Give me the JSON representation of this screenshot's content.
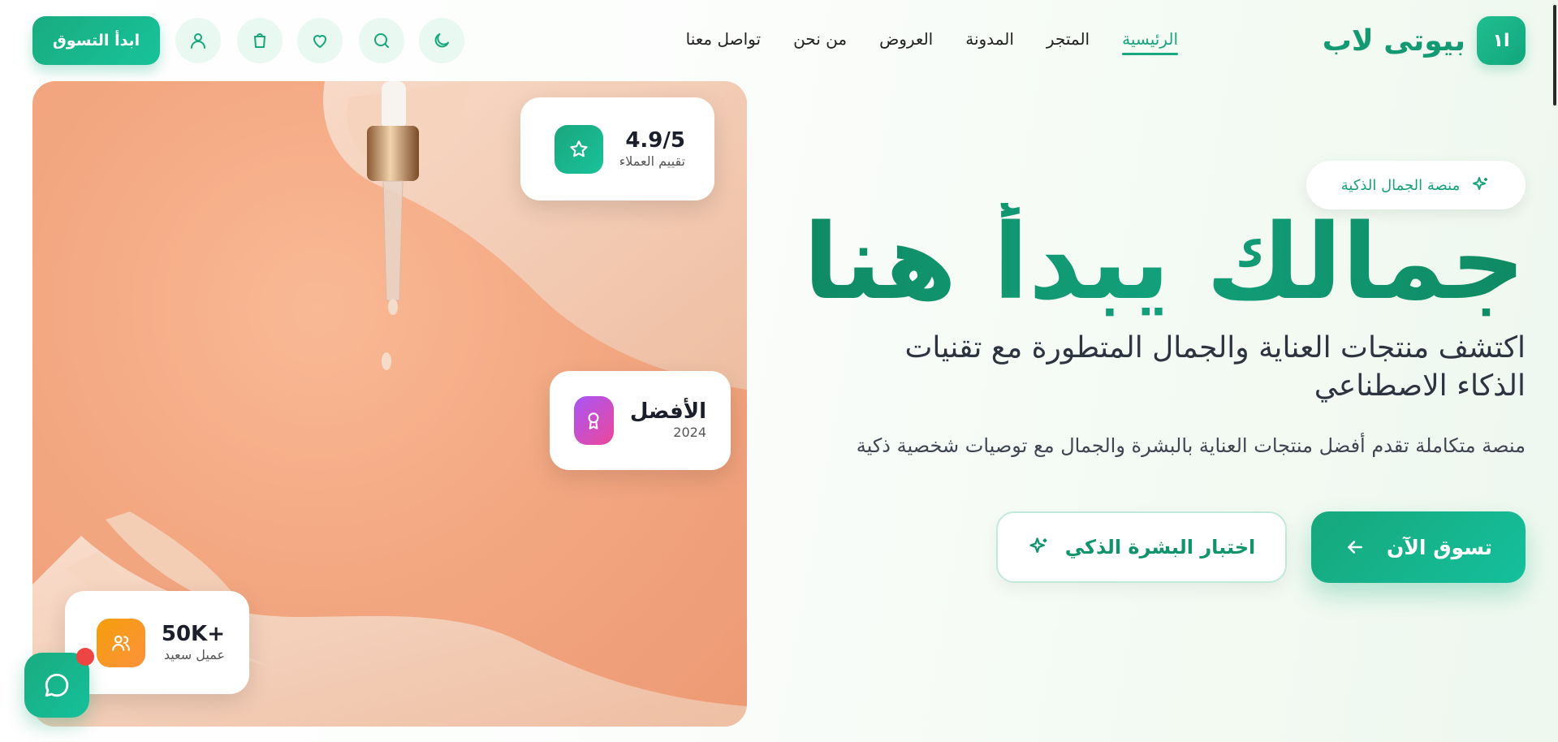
{
  "brand": {
    "logo_mark": "ا١",
    "name": "بيوتى لاب",
    "accent_color": "#17a77c",
    "accent_light": "#e9f8f1",
    "chat_badge_color": "#ef4444"
  },
  "nav": {
    "items": [
      {
        "label": "الرئيسية",
        "active": true
      },
      {
        "label": "المتجر",
        "active": false
      },
      {
        "label": "المدونة",
        "active": false
      },
      {
        "label": "العروض",
        "active": false
      },
      {
        "label": "من نحن",
        "active": false
      },
      {
        "label": "تواصل معنا",
        "active": false
      }
    ]
  },
  "header_actions": {
    "icons": [
      "moon-icon",
      "search-icon",
      "heart-icon",
      "shopping-bag-icon",
      "user-icon"
    ],
    "start_shopping_label": "ابدأ التسوق"
  },
  "hero": {
    "badge_icon": "sparkles-icon",
    "badge_text": "منصة الجمال الذكية",
    "title": "جمالك يبدأ هنا",
    "subtitle": "اكتشف منتجات العناية والجمال المتطورة مع تقنيات الذكاء الاصطناعي",
    "description": "منصة متكاملة تقدم أفضل منتجات العناية بالبشرة والجمال مع توصيات شخصية ذكية",
    "primary_cta": {
      "label": "تسوق الآن",
      "icon": "arrow-left-icon"
    },
    "secondary_cta": {
      "label": "اختبار البشرة الذكي",
      "icon": "sparkles-icon"
    }
  },
  "stats": {
    "rating": {
      "value": "4.9/5",
      "label": "تقييم العملاء",
      "icon": "star-icon",
      "color": "#18b489"
    },
    "award": {
      "value": "الأفضل",
      "label": "2024",
      "icon": "award-icon",
      "color": "#c24fd6"
    },
    "clients": {
      "value": "+50K",
      "label": "عميل سعيد",
      "icon": "users-icon",
      "color": "#f59e0b"
    }
  },
  "chat": {
    "icon": "chat-bubble-icon"
  }
}
